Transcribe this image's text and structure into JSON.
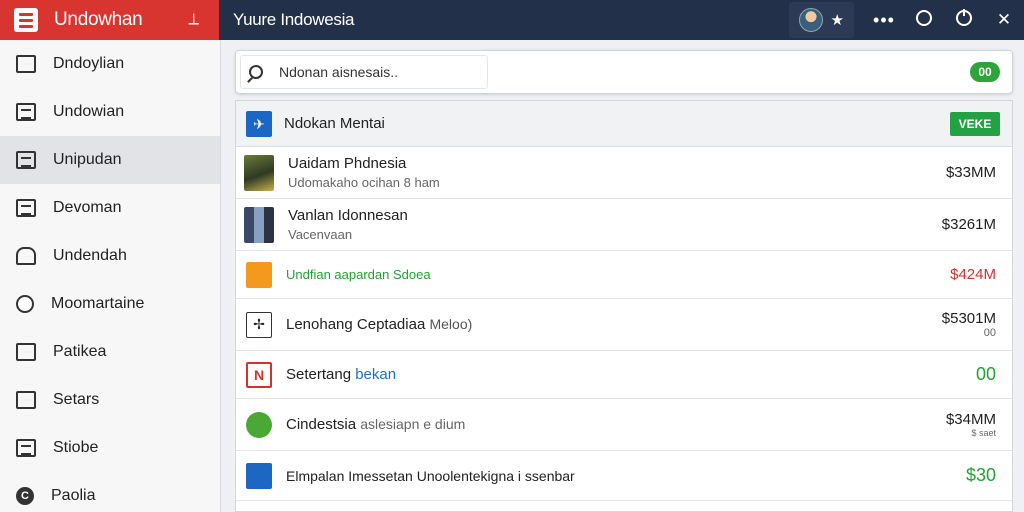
{
  "brand": {
    "title": "Undowhan",
    "action_icon": "pin-icon"
  },
  "titlebar": {
    "title": "Yuure Indowesia"
  },
  "sidebar": {
    "items": [
      {
        "label": "Dndoylian",
        "icon": "folder-icon"
      },
      {
        "label": "Undowian",
        "icon": "image-icon"
      },
      {
        "label": "Unipudan",
        "icon": "list-icon",
        "active": true
      },
      {
        "label": "Devoman",
        "icon": "document-icon"
      },
      {
        "label": "Undendah",
        "icon": "bell-icon"
      },
      {
        "label": "Moomartaine",
        "icon": "chat-icon"
      },
      {
        "label": "Patikea",
        "icon": "clipboard-icon"
      },
      {
        "label": "Setars",
        "icon": "calendar-icon"
      },
      {
        "label": "Stiobe",
        "icon": "note-icon"
      },
      {
        "label": "Paolia",
        "icon": "c-circle-icon"
      }
    ]
  },
  "search": {
    "value": "Ndonan aisnesais..",
    "badge": "00"
  },
  "list": {
    "header": {
      "title": "Ndokan Mentai",
      "button": "VEKE"
    },
    "rows": [
      {
        "title": "Uaidam Phdnesia",
        "sub": "Udomakaho ocihan 8 ham",
        "value": "$33MM",
        "value_sub": ""
      },
      {
        "title": "Vanlan Idonnesan",
        "sub": "Vacenvaan",
        "value": "$3261M",
        "value_sub": ""
      },
      {
        "title": "Undfian aapardan Sdoea",
        "sub": "",
        "value": "$424M",
        "value_sub": ""
      },
      {
        "title": "Lenohang Ceptadiaa",
        "title_extra": "Meloo)",
        "sub": "",
        "value": "$5301M",
        "value_sub": "00"
      },
      {
        "title": "Setertang",
        "title_extra": "bekan",
        "sub": "",
        "value": "00",
        "value_sub": ""
      },
      {
        "title": "Cindestsia",
        "title_extra": "aslesiapn e dium",
        "sub": "",
        "value": "$34MM",
        "value_sub": "$ saet"
      },
      {
        "title": "Elmpalan Imessetan Unoolentekigna i ssenbar",
        "sub": "",
        "value": "$30",
        "value_sub": ""
      }
    ]
  },
  "colors": {
    "brand": "#d93530",
    "titlebar": "#223049",
    "accent_green": "#24a132",
    "accent_red": "#d2332c",
    "accent_blue": "#1a73c9"
  }
}
